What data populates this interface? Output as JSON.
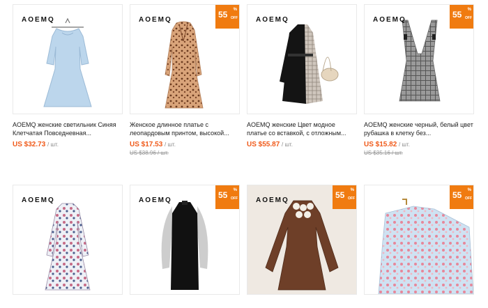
{
  "products": [
    {
      "brand": "AOEMQ",
      "discount": "",
      "title": "AOEMQ женские светильник Синяя Клетчатая Повседневная...",
      "price": "US $32.73",
      "unit": "/ шт.",
      "old_price": "",
      "image": "light-blue-puff-sleeve-dress"
    },
    {
      "brand": "AOEMQ",
      "discount": "55",
      "title": "Женское длинное платье с леопардовым принтом, высокой...",
      "price": "US $17.53",
      "unit": "/ шт.",
      "old_price": "US $38.96 / шт.",
      "image": "leopard-print-maxi-dress"
    },
    {
      "brand": "AOEMQ",
      "discount": "",
      "title": "AOEMQ женские Цвет модное платье со вставкой, с отложным...",
      "price": "US $55.87",
      "unit": "/ шт.",
      "old_price": "",
      "image": "black-plaid-patchwork-dress"
    },
    {
      "brand": "AOEMQ",
      "discount": "55",
      "title": "AOEMQ женские черный, белый цвет рубашка в клетку без...",
      "price": "US $15.82",
      "unit": "/ шт.",
      "old_price": "US $35.16 / шт.",
      "image": "grey-plaid-pinafore-dress"
    },
    {
      "brand": "AOEMQ",
      "discount": "",
      "title": "",
      "price": "",
      "unit": "",
      "old_price": "",
      "image": "floral-print-midi-dress"
    },
    {
      "brand": "AOEMQ",
      "discount": "55",
      "title": "",
      "price": "",
      "unit": "",
      "old_price": "",
      "image": "black-mesh-sleeve-dress"
    },
    {
      "brand": "AOEMQ",
      "discount": "55",
      "title": "",
      "price": "",
      "unit": "",
      "old_price": "",
      "image": "brown-embroidered-collar-dress"
    },
    {
      "brand": "",
      "discount": "55",
      "title": "",
      "price": "",
      "unit": "",
      "old_price": "",
      "image": "blue-floral-dress"
    }
  ],
  "badge": {
    "percent_symbol": "%",
    "off_label": "OFF"
  },
  "colors": {
    "accent": "#f07b10",
    "price": "#f05a1a"
  }
}
